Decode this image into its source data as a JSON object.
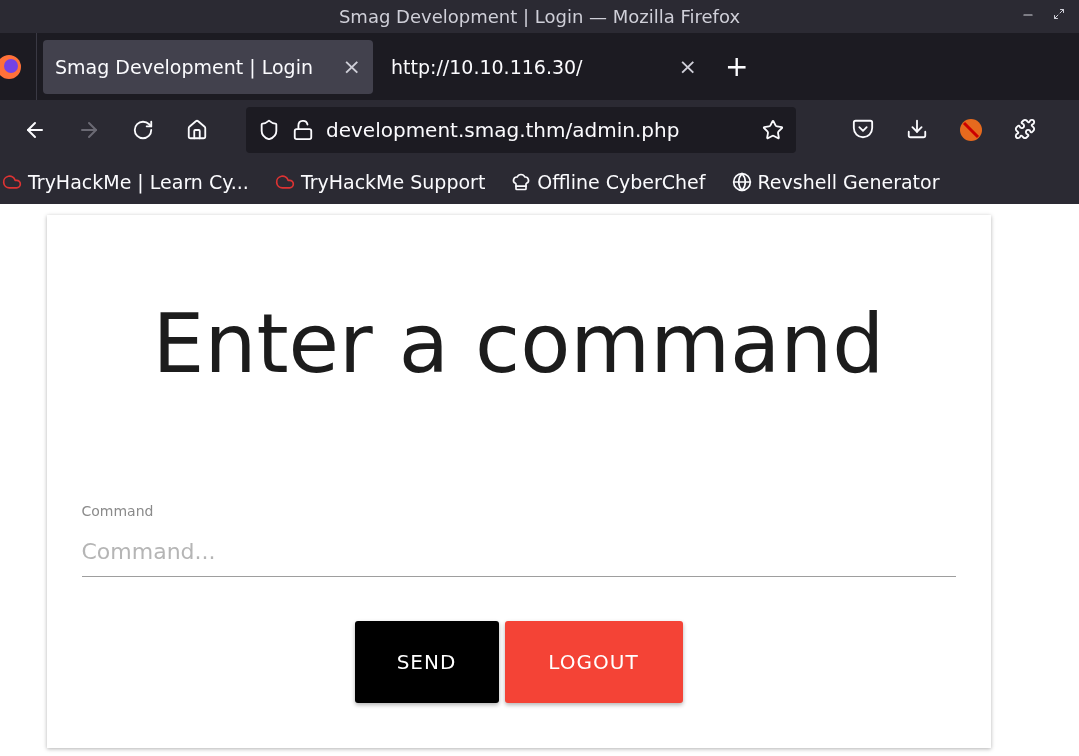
{
  "window": {
    "title": "Smag Development | Login — Mozilla Firefox"
  },
  "tabs": [
    {
      "label": "Smag Development | Login",
      "close": "×",
      "selected": true
    },
    {
      "label": "http://10.10.116.30/",
      "close": "×",
      "selected": false
    }
  ],
  "new_tab": "+",
  "address_bar": {
    "url": "development.smag.thm/admin.php"
  },
  "bookmarks": [
    {
      "label": "TryHackMe | Learn Cy...",
      "kind": "cloud"
    },
    {
      "label": "TryHackMe Support",
      "kind": "cloud"
    },
    {
      "label": "Offline CyberChef",
      "kind": "chef"
    },
    {
      "label": "Revshell Generator",
      "kind": "globe"
    }
  ],
  "page": {
    "heading": "Enter a command",
    "field": {
      "label": "Command",
      "placeholder": "Command..."
    },
    "buttons": [
      {
        "label": "SEND",
        "kind": "primary"
      },
      {
        "label": "LOGOUT",
        "kind": "danger"
      }
    ]
  }
}
